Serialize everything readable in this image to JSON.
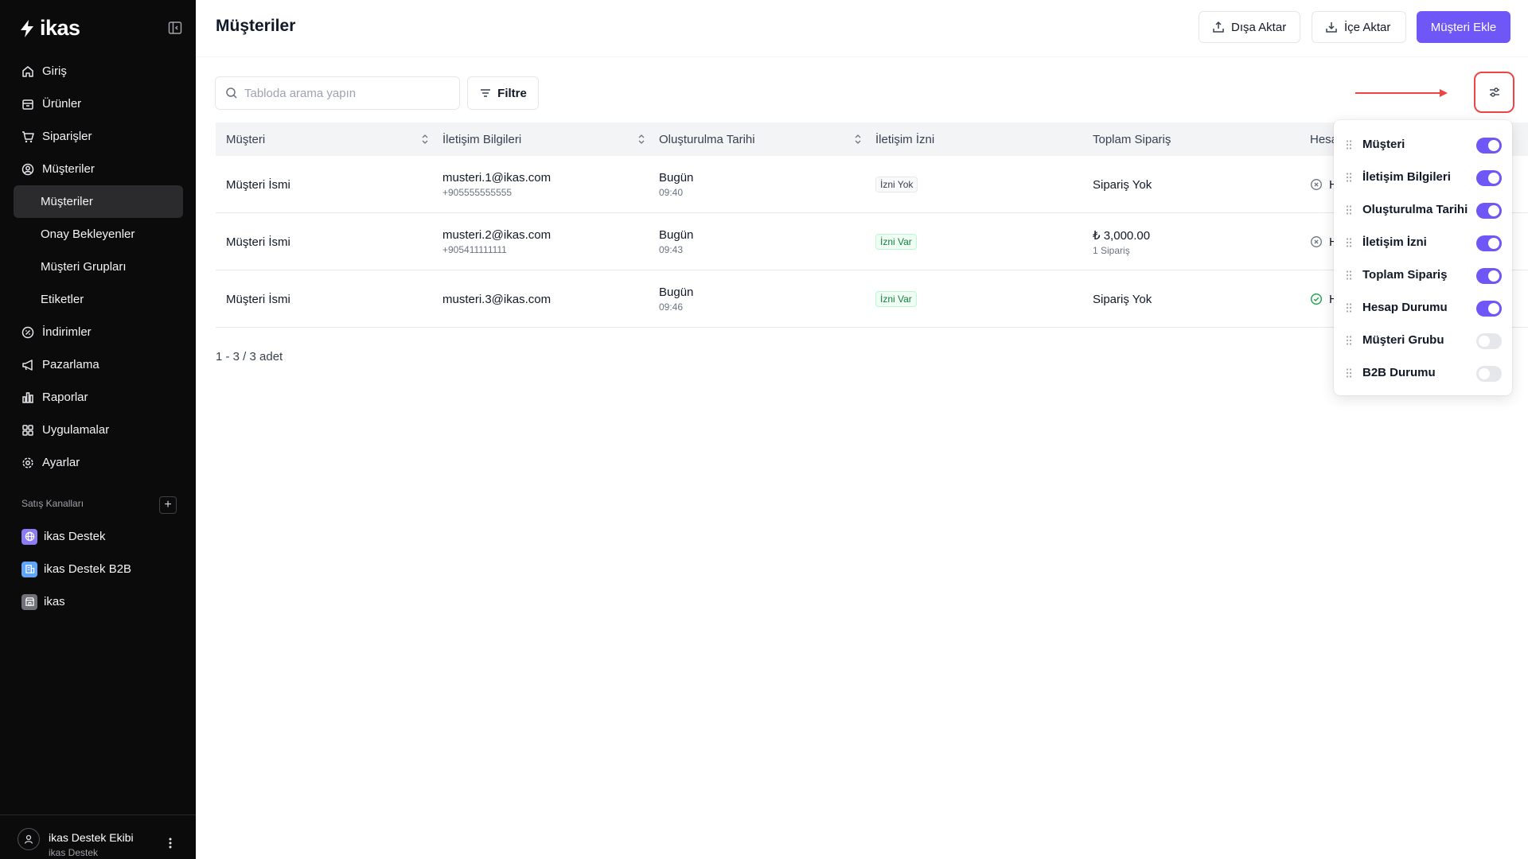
{
  "brand": {
    "name": "ikas",
    "accent": "#6e56f7"
  },
  "sidebar": {
    "items": [
      {
        "label": "Giriş",
        "icon": "home-icon"
      },
      {
        "label": "Ürünler",
        "icon": "box-icon"
      },
      {
        "label": "Siparişler",
        "icon": "cart-icon"
      },
      {
        "label": "Müşteriler",
        "icon": "user-circle-icon"
      },
      {
        "label": "Müşteriler",
        "sub": true,
        "active": true
      },
      {
        "label": "Onay Bekleyenler",
        "sub": true
      },
      {
        "label": "Müşteri Grupları",
        "sub": true
      },
      {
        "label": "Etiketler",
        "sub": true
      },
      {
        "label": "İndirimler",
        "icon": "discount-icon"
      },
      {
        "label": "Pazarlama",
        "icon": "megaphone-icon"
      },
      {
        "label": "Raporlar",
        "icon": "chart-icon"
      },
      {
        "label": "Uygulamalar",
        "icon": "apps-icon"
      },
      {
        "label": "Ayarlar",
        "icon": "gear-icon"
      }
    ],
    "channels_title": "Satış Kanalları",
    "channels": [
      {
        "label": "ikas Destek",
        "icon": "globe-icon",
        "color": "#a78bfa"
      },
      {
        "label": "ikas Destek B2B",
        "icon": "building-icon",
        "color": "#7dd3fc"
      },
      {
        "label": "ikas",
        "icon": "store-icon",
        "color": "#9ca3af"
      }
    ],
    "user": {
      "name": "ikas Destek Ekibi",
      "org": "ikas Destek"
    }
  },
  "header": {
    "title": "Müşteriler",
    "export_label": "Dışa Aktar",
    "import_label": "İçe Aktar",
    "add_label": "Müşteri Ekle"
  },
  "toolbar": {
    "search_placeholder": "Tabloda arama yapın",
    "filter_label": "Filtre"
  },
  "table": {
    "columns": [
      "Müşteri",
      "İletişim Bilgileri",
      "Oluşturulma Tarihi",
      "İletişim İzni",
      "Toplam Sipariş",
      "Hesa"
    ],
    "rows": [
      {
        "customer": "Müşteri İsmi",
        "email": "musteri.1@ikas.com",
        "phone": "+905555555555",
        "date": "Bugün",
        "time": "09:40",
        "permission": "İzni Yok",
        "permission_ok": false,
        "orders": "Sipariş Yok",
        "orders_sub": "",
        "status_text": "H",
        "status_ok": false
      },
      {
        "customer": "Müşteri İsmi",
        "email": "musteri.2@ikas.com",
        "phone": "+905411111111",
        "date": "Bugün",
        "time": "09:43",
        "permission": "İzni Var",
        "permission_ok": true,
        "orders": "₺ 3,000.00",
        "orders_sub": "1 Sipariş",
        "status_text": "H",
        "status_ok": false
      },
      {
        "customer": "Müşteri İsmi",
        "email": "musteri.3@ikas.com",
        "phone": "",
        "date": "Bugün",
        "time": "09:46",
        "permission": "İzni Var",
        "permission_ok": true,
        "orders": "Sipariş Yok",
        "orders_sub": "",
        "status_text": "H",
        "status_ok": true
      }
    ]
  },
  "pagination": {
    "text": "1 - 3 / 3 adet"
  },
  "column_settings": {
    "items": [
      {
        "label": "Müşteri",
        "enabled": true
      },
      {
        "label": "İletişim Bilgileri",
        "enabled": true
      },
      {
        "label": "Oluşturulma Tarihi",
        "enabled": true
      },
      {
        "label": "İletişim İzni",
        "enabled": true
      },
      {
        "label": "Toplam Sipariş",
        "enabled": true
      },
      {
        "label": "Hesap Durumu",
        "enabled": true
      },
      {
        "label": "Müşteri Grubu",
        "enabled": false
      },
      {
        "label": "B2B Durumu",
        "enabled": false
      }
    ]
  }
}
